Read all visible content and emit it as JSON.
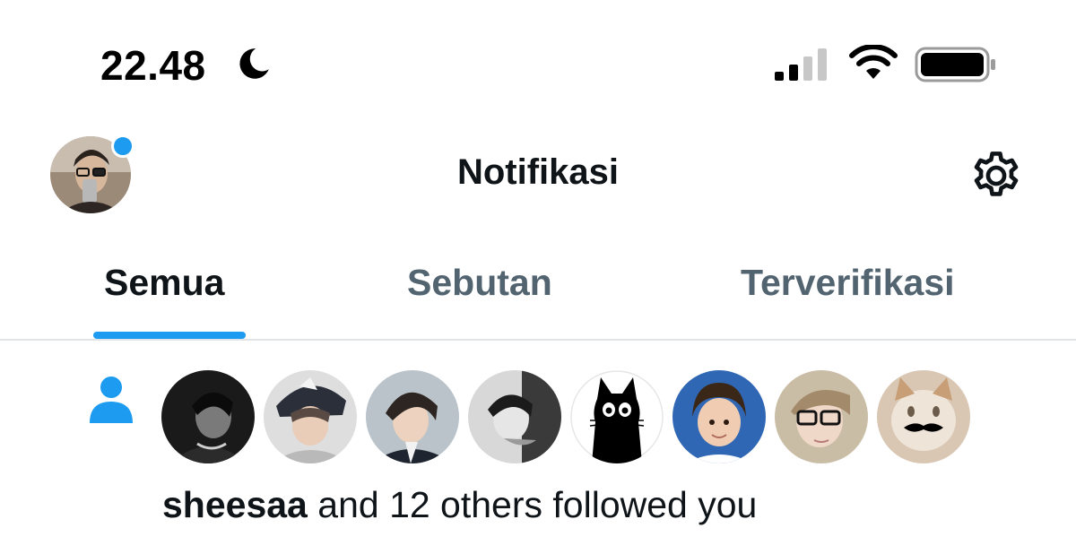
{
  "status_bar": {
    "time": "22.48",
    "icons": [
      "moon-icon",
      "cellular-signal-icon",
      "wifi-icon",
      "battery-icon"
    ]
  },
  "header": {
    "title": "Notifikasi",
    "settings_icon": "gear-icon"
  },
  "tabs": [
    {
      "label": "Semua",
      "active": true
    },
    {
      "label": "Sebutan",
      "active": false
    },
    {
      "label": "Terverifikasi",
      "active": false
    }
  ],
  "notification": {
    "icon": "person-icon",
    "follower_avatar_count": 8,
    "user": "sheesaa",
    "message": "and 12 others followed you"
  },
  "colors": {
    "accent": "#1d9bf0",
    "text_primary": "#0f1419",
    "text_secondary": "#536471"
  }
}
